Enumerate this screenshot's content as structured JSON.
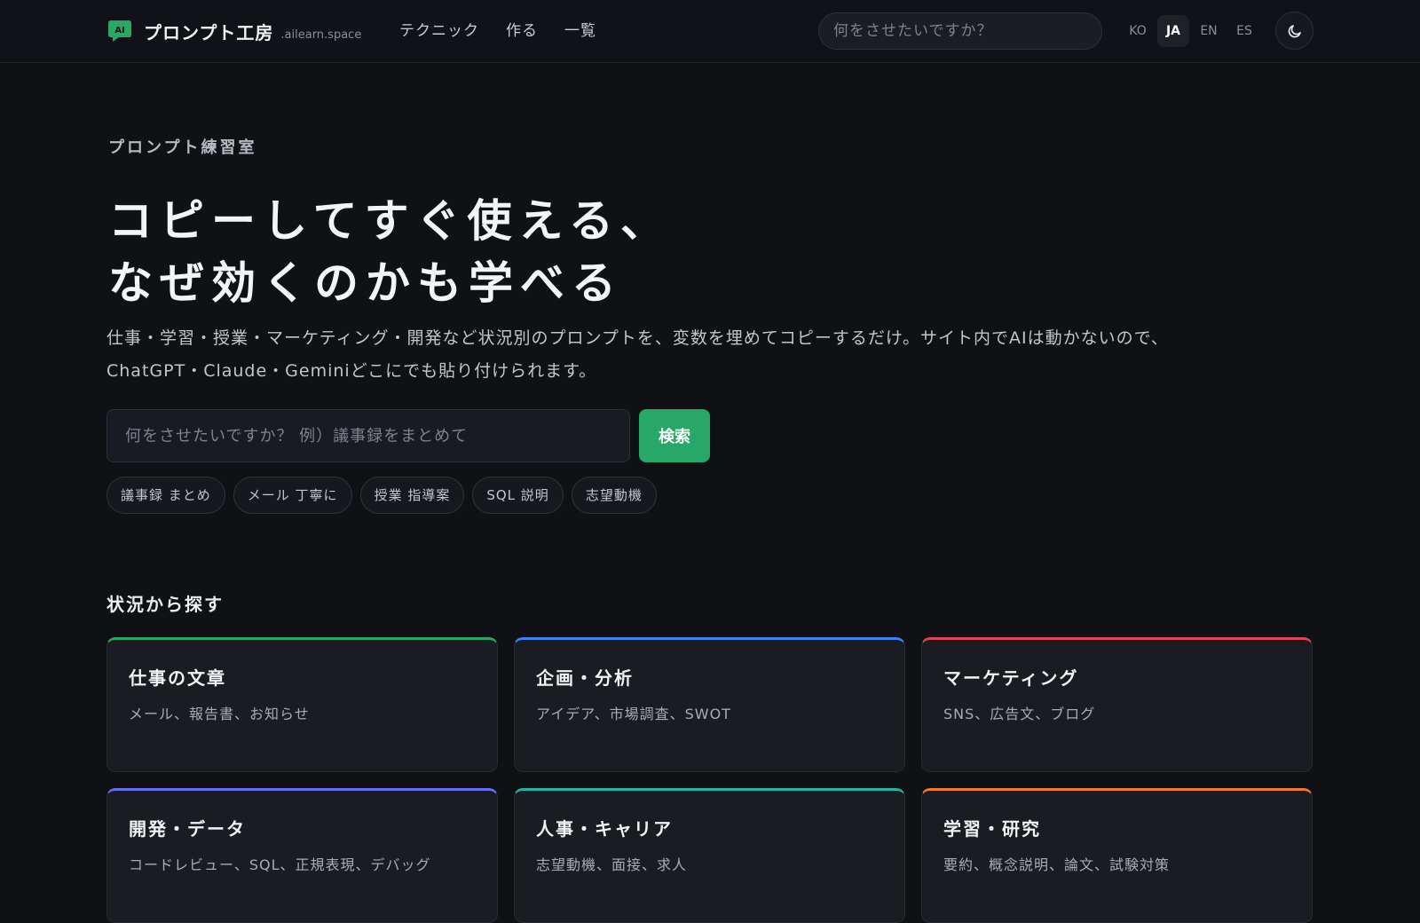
{
  "header": {
    "brand_name": "プロンプト工房",
    "brand_domain": ".ailearn.space",
    "nav": [
      {
        "label": "テクニック"
      },
      {
        "label": "作る"
      },
      {
        "label": "一覧"
      }
    ],
    "search_placeholder": "何をさせたいですか？",
    "languages": [
      {
        "label": "KO",
        "active": false
      },
      {
        "label": "JA",
        "active": true
      },
      {
        "label": "EN",
        "active": false
      },
      {
        "label": "ES",
        "active": false
      }
    ],
    "theme_icon": "moon-icon"
  },
  "hero": {
    "eyebrow": "プロンプト練習室",
    "title_line1": "コピーしてすぐ使える、",
    "title_line2": "なぜ効くのかも学べる",
    "desc_line1": "仕事・学習・授業・マーケティング・開発など状況別のプロンプトを、変数を埋めてコピーするだけ。サイト内でAIは動かないので、",
    "desc_line2": "ChatGPT・Claude・Geminiどこにでも貼り付けられます。",
    "search_placeholder": "何をさせたいですか？ 例）議事録をまとめて",
    "search_button": "検索",
    "chips": [
      {
        "label": "議事録 まとめ"
      },
      {
        "label": "メール 丁寧に"
      },
      {
        "label": "授業 指導案"
      },
      {
        "label": "SQL 説明"
      },
      {
        "label": "志望動機"
      }
    ]
  },
  "categories": {
    "title": "状況から探す",
    "items": [
      {
        "title": "仕事の文章",
        "sub": "メール、報告書、お知らせ",
        "color": "#27a866"
      },
      {
        "title": "企画・分析",
        "sub": "アイデア、市場調査、SWOT",
        "color": "#3b82f6"
      },
      {
        "title": "マーケティング",
        "sub": "SNS、広告文、ブログ",
        "color": "#e0445c"
      },
      {
        "title": "開発・データ",
        "sub": "コードレビュー、SQL、正規表現、デバッグ",
        "color": "#6c6cf0"
      },
      {
        "title": "人事・キャリア",
        "sub": "志望動機、面接、求人",
        "color": "#1fb5a0"
      },
      {
        "title": "学習・研究",
        "sub": "要約、概念説明、論文、試験対策",
        "color": "#f07a2a"
      }
    ]
  },
  "colors": {
    "accent": "#27a866",
    "background": "#0f1115"
  }
}
